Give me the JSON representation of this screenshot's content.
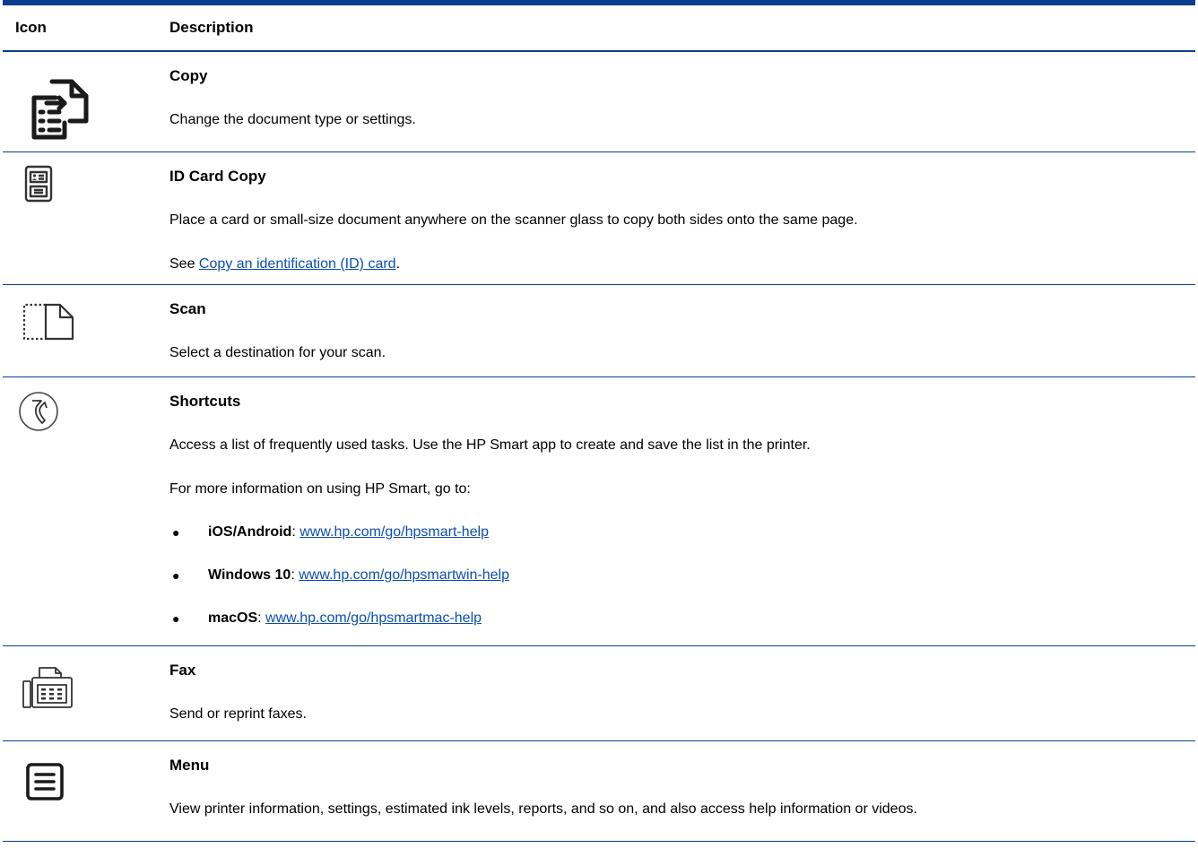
{
  "header": {
    "icon_col": "Icon",
    "desc_col": "Description"
  },
  "rows": [
    {
      "icon": "copy-icon",
      "title": "Copy",
      "desc": "Change the document type or settings."
    },
    {
      "icon": "id-card-copy-icon",
      "title": "ID Card Copy",
      "desc": "Place a card or small-size document anywhere on the scanner glass to copy both sides onto the same page.",
      "see_prefix": "See ",
      "see_link": "Copy an identification (ID) card",
      "see_suffix": "."
    },
    {
      "icon": "scan-icon",
      "title": "Scan",
      "desc": "Select a destination for your scan."
    },
    {
      "icon": "shortcuts-icon",
      "title": "Shortcuts",
      "desc": "Access a list of frequently used tasks. Use the HP Smart app to create and save the list in the printer.",
      "desc2": "For more information on using HP Smart, go to:",
      "bullets": [
        {
          "label": "iOS/Android",
          "sep": ": ",
          "link": "www.hp.com/go/hpsmart-help"
        },
        {
          "label": "Windows 10",
          "sep": ": ",
          "link": "www.hp.com/go/hpsmartwin-help"
        },
        {
          "label": "macOS",
          "sep": ": ",
          "link": "www.hp.com/go/hpsmartmac-help"
        }
      ]
    },
    {
      "icon": "fax-icon",
      "title": "Fax",
      "desc": "Send or reprint faxes."
    },
    {
      "icon": "menu-icon",
      "title": "Menu",
      "desc": "View printer information, settings, estimated ink levels, reports, and so on, and also access help information or videos."
    }
  ],
  "colors": {
    "rule": "#0a3d8f",
    "link": "#0a4fb0"
  }
}
